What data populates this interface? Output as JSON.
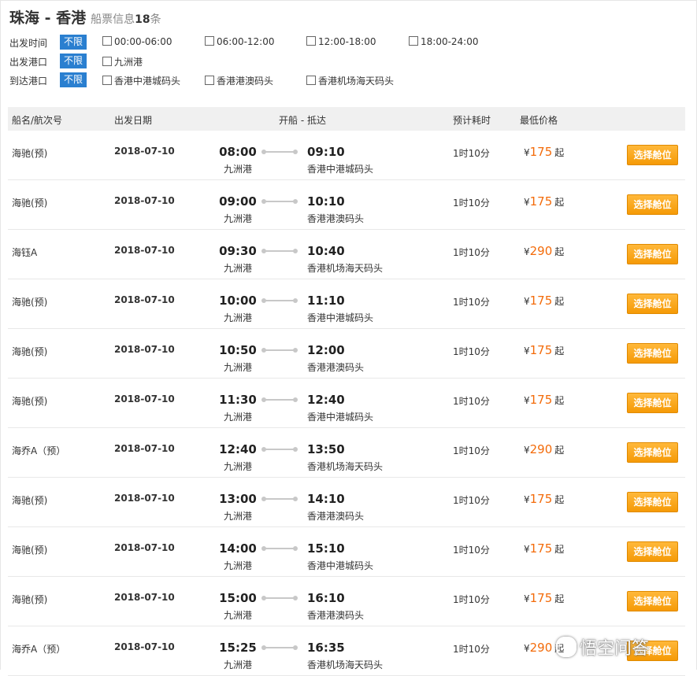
{
  "header": {
    "route": "珠海 - 香港",
    "subtitle": "船票信息",
    "count": "18",
    "unit": "条"
  },
  "filters": {
    "time": {
      "label": "出发时间",
      "all": "不限",
      "options": [
        "00:00-06:00",
        "06:00-12:00",
        "12:00-18:00",
        "18:00-24:00"
      ]
    },
    "departure_port": {
      "label": "出发港口",
      "all": "不限",
      "options": [
        "九洲港"
      ]
    },
    "arrival_port": {
      "label": "到达港口",
      "all": "不限",
      "options": [
        "香港中港城码头",
        "香港港澳码头",
        "香港机场海天码头"
      ]
    }
  },
  "table": {
    "headers": {
      "ship": "船名/航次号",
      "date": "出发日期",
      "times": "开船 - 抵达",
      "duration": "预计耗时",
      "price": "最低价格"
    },
    "currency": "¥",
    "from_suffix": "起",
    "button_label": "选择舱位",
    "rows": [
      {
        "ship": "海驰(预)",
        "date": "2018-07-10",
        "dep": "08:00",
        "dep_port": "九洲港",
        "arr": "09:10",
        "arr_port": "香港中港城码头",
        "duration": "1时10分",
        "price": "175"
      },
      {
        "ship": "海驰(预)",
        "date": "2018-07-10",
        "dep": "09:00",
        "dep_port": "九洲港",
        "arr": "10:10",
        "arr_port": "香港港澳码头",
        "duration": "1时10分",
        "price": "175"
      },
      {
        "ship": "海钰A",
        "date": "2018-07-10",
        "dep": "09:30",
        "dep_port": "九洲港",
        "arr": "10:40",
        "arr_port": "香港机场海天码头",
        "duration": "1时10分",
        "price": "290"
      },
      {
        "ship": "海驰(预)",
        "date": "2018-07-10",
        "dep": "10:00",
        "dep_port": "九洲港",
        "arr": "11:10",
        "arr_port": "香港中港城码头",
        "duration": "1时10分",
        "price": "175"
      },
      {
        "ship": "海驰(预)",
        "date": "2018-07-10",
        "dep": "10:50",
        "dep_port": "九洲港",
        "arr": "12:00",
        "arr_port": "香港港澳码头",
        "duration": "1时10分",
        "price": "175"
      },
      {
        "ship": "海驰(预)",
        "date": "2018-07-10",
        "dep": "11:30",
        "dep_port": "九洲港",
        "arr": "12:40",
        "arr_port": "香港中港城码头",
        "duration": "1时10分",
        "price": "175"
      },
      {
        "ship": "海乔A（预）",
        "date": "2018-07-10",
        "dep": "12:40",
        "dep_port": "九洲港",
        "arr": "13:50",
        "arr_port": "香港机场海天码头",
        "duration": "1时10分",
        "price": "290"
      },
      {
        "ship": "海驰(预)",
        "date": "2018-07-10",
        "dep": "13:00",
        "dep_port": "九洲港",
        "arr": "14:10",
        "arr_port": "香港港澳码头",
        "duration": "1时10分",
        "price": "175"
      },
      {
        "ship": "海驰(预)",
        "date": "2018-07-10",
        "dep": "14:00",
        "dep_port": "九洲港",
        "arr": "15:10",
        "arr_port": "香港中港城码头",
        "duration": "1时10分",
        "price": "175"
      },
      {
        "ship": "海驰(预)",
        "date": "2018-07-10",
        "dep": "15:00",
        "dep_port": "九洲港",
        "arr": "16:10",
        "arr_port": "香港港澳码头",
        "duration": "1时10分",
        "price": "175"
      },
      {
        "ship": "海乔A（预）",
        "date": "2018-07-10",
        "dep": "15:25",
        "dep_port": "九洲港",
        "arr": "16:35",
        "arr_port": "香港机场海天码头",
        "duration": "1时10分",
        "price": "290"
      }
    ]
  },
  "watermark": "悟空问答",
  "colors": {
    "accent_blue": "#2a7fd0",
    "price_orange": "#f36b0a",
    "button_orange": "#f59a06"
  }
}
